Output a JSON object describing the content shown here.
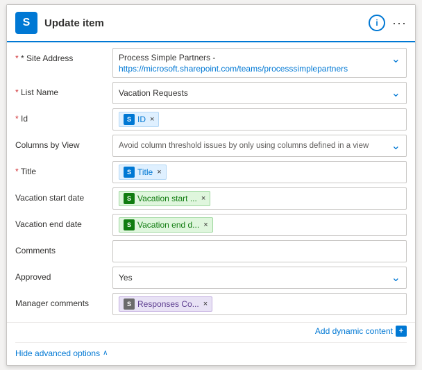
{
  "header": {
    "icon_letter": "S",
    "title": "Update item",
    "info_label": "i",
    "more_label": "···"
  },
  "fields": {
    "site_address": {
      "label": "* Site Address",
      "line1": "Process Simple Partners -",
      "url": "https://microsoft.sharepoint.com/teams/processsimplepartners"
    },
    "list_name": {
      "label": "* List Name",
      "value": "Vacation Requests"
    },
    "id": {
      "label": "* Id",
      "chip_label": "ID",
      "chip_icon": "S"
    },
    "limit_columns": {
      "label": "Columns by View",
      "placeholder": "Avoid column threshold issues by only using columns defined in a view"
    },
    "title": {
      "label": "* Title",
      "chip_label": "Title",
      "chip_icon": "S"
    },
    "vacation_start": {
      "label": "Vacation start date",
      "chip_label": "Vacation start ...",
      "chip_icon": "S"
    },
    "vacation_end": {
      "label": "Vacation end date",
      "chip_label": "Vacation end d...",
      "chip_icon": "S"
    },
    "comments": {
      "label": "Comments"
    },
    "approved": {
      "label": "Approved",
      "value": "Yes"
    },
    "manager_comments": {
      "label": "Manager comments",
      "chip_label": "Responses Co...",
      "chip_icon": "S"
    }
  },
  "footer": {
    "add_dynamic_label": "Add dynamic content",
    "add_dynamic_icon": "+",
    "hide_advanced_label": "Hide advanced options",
    "chevron_up": "∧"
  }
}
